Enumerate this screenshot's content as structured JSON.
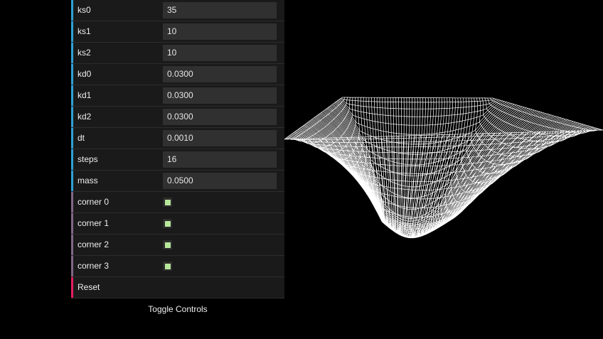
{
  "controls": {
    "params": [
      {
        "label": "ks0",
        "value": "35"
      },
      {
        "label": "ks1",
        "value": "10"
      },
      {
        "label": "ks2",
        "value": "10"
      },
      {
        "label": "kd0",
        "value": "0.0300"
      },
      {
        "label": "kd1",
        "value": "0.0300"
      },
      {
        "label": "kd2",
        "value": "0.0300"
      },
      {
        "label": "dt",
        "value": "0.0010"
      },
      {
        "label": "steps",
        "value": "16"
      },
      {
        "label": "mass",
        "value": "0.0500"
      }
    ],
    "corners": [
      {
        "label": "corner 0",
        "checked": true
      },
      {
        "label": "corner 1",
        "checked": true
      },
      {
        "label": "corner 2",
        "checked": true
      },
      {
        "label": "corner 3",
        "checked": true
      }
    ],
    "reset_label": "Reset",
    "toggle_label": "Toggle Controls"
  },
  "colors": {
    "number_stripe": "#2fa1d6",
    "boolean_stripe": "#806787",
    "function_stripe": "#e61d5f",
    "checkbox_fill": "#b7e79b",
    "mesh": "#ffffff",
    "background": "#000000"
  }
}
